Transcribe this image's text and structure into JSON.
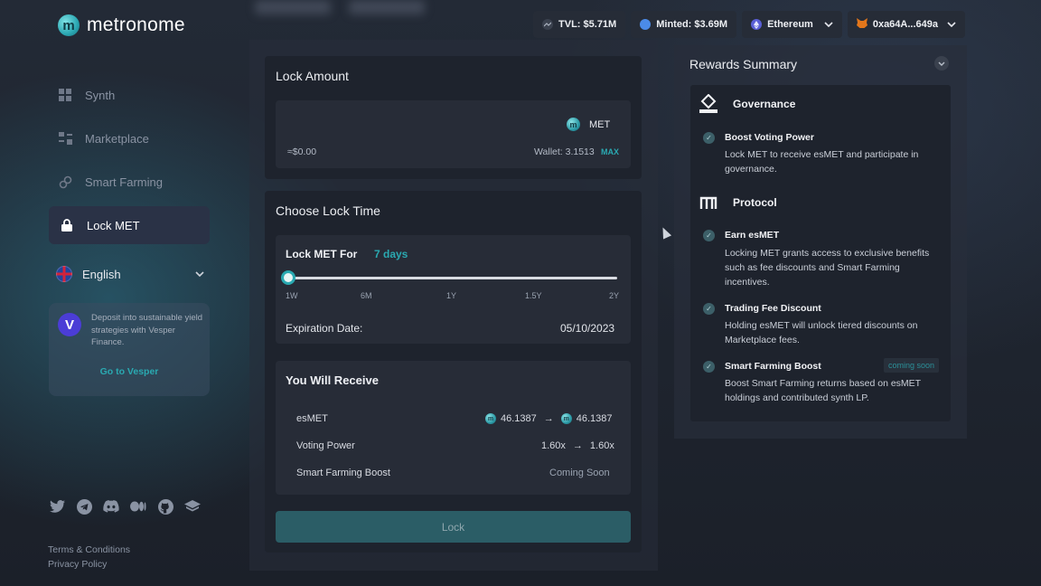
{
  "app": {
    "name": "metronome",
    "logo_glyph": "m"
  },
  "nav": {
    "items": [
      {
        "label": "Synth",
        "icon": "grid-icon"
      },
      {
        "label": "Marketplace",
        "icon": "marketplace-icon"
      },
      {
        "label": "Smart Farming",
        "icon": "farming-icon"
      },
      {
        "label": "Lock MET",
        "icon": "lock-icon",
        "active": true
      }
    ]
  },
  "language": {
    "label": "English"
  },
  "vesper": {
    "glyph": "V",
    "text": "Deposit into sustainable yield strategies with Vesper Finance.",
    "link": "Go to Vesper"
  },
  "footer": {
    "terms": "Terms & Conditions",
    "privacy": "Privacy Policy"
  },
  "topbar": {
    "tvl": "TVL: $5.71M",
    "minted": "Minted: $3.69M",
    "network": "Ethereum",
    "wallet": "0xa64A...649a"
  },
  "lock_amount": {
    "title": "Lock Amount",
    "token": "MET",
    "usd_value": "≈$0.00",
    "wallet": "Wallet: 3.1513",
    "max_label": "MAX"
  },
  "lock_time": {
    "title": "Choose Lock Time",
    "for_label": "Lock MET For",
    "duration": "7 days",
    "slider_fraction": 0,
    "ticks": [
      "1W",
      "6M",
      "1Y",
      "1.5Y",
      "2Y"
    ],
    "expiration_label": "Expiration Date:",
    "expiration_value": "05/10/2023"
  },
  "receive": {
    "title": "You Will Receive",
    "rows": [
      {
        "label": "esMET",
        "from": "46.1387",
        "to": "46.1387"
      },
      {
        "label": "Voting Power",
        "from": "1.60x",
        "to": "1.60x"
      },
      {
        "label": "Smart Farming Boost",
        "value": "Coming Soon"
      }
    ],
    "arrow": "→"
  },
  "lock_button": "Lock",
  "rewards": {
    "title": "Rewards Summary",
    "governance": {
      "title": "Governance",
      "items": [
        {
          "title": "Boost Voting Power",
          "desc": "Lock MET to receive esMET and participate in governance."
        }
      ]
    },
    "protocol": {
      "title": "Protocol",
      "items": [
        {
          "title": "Earn esMET",
          "desc": "Locking MET grants access to exclusive benefits such as fee discounts and Smart Farming incentives."
        },
        {
          "title": "Trading Fee Discount",
          "desc": "Holding esMET will unlock tiered discounts on Marketplace fees."
        },
        {
          "title": "Smart Farming Boost",
          "desc": "Boost Smart Farming returns based on esMET holdings and contributed synth LP.",
          "badge": "coming soon"
        }
      ]
    }
  },
  "colors": {
    "accent": "#2aa9b1",
    "panel": "#1e232d",
    "inner": "#272c37"
  }
}
